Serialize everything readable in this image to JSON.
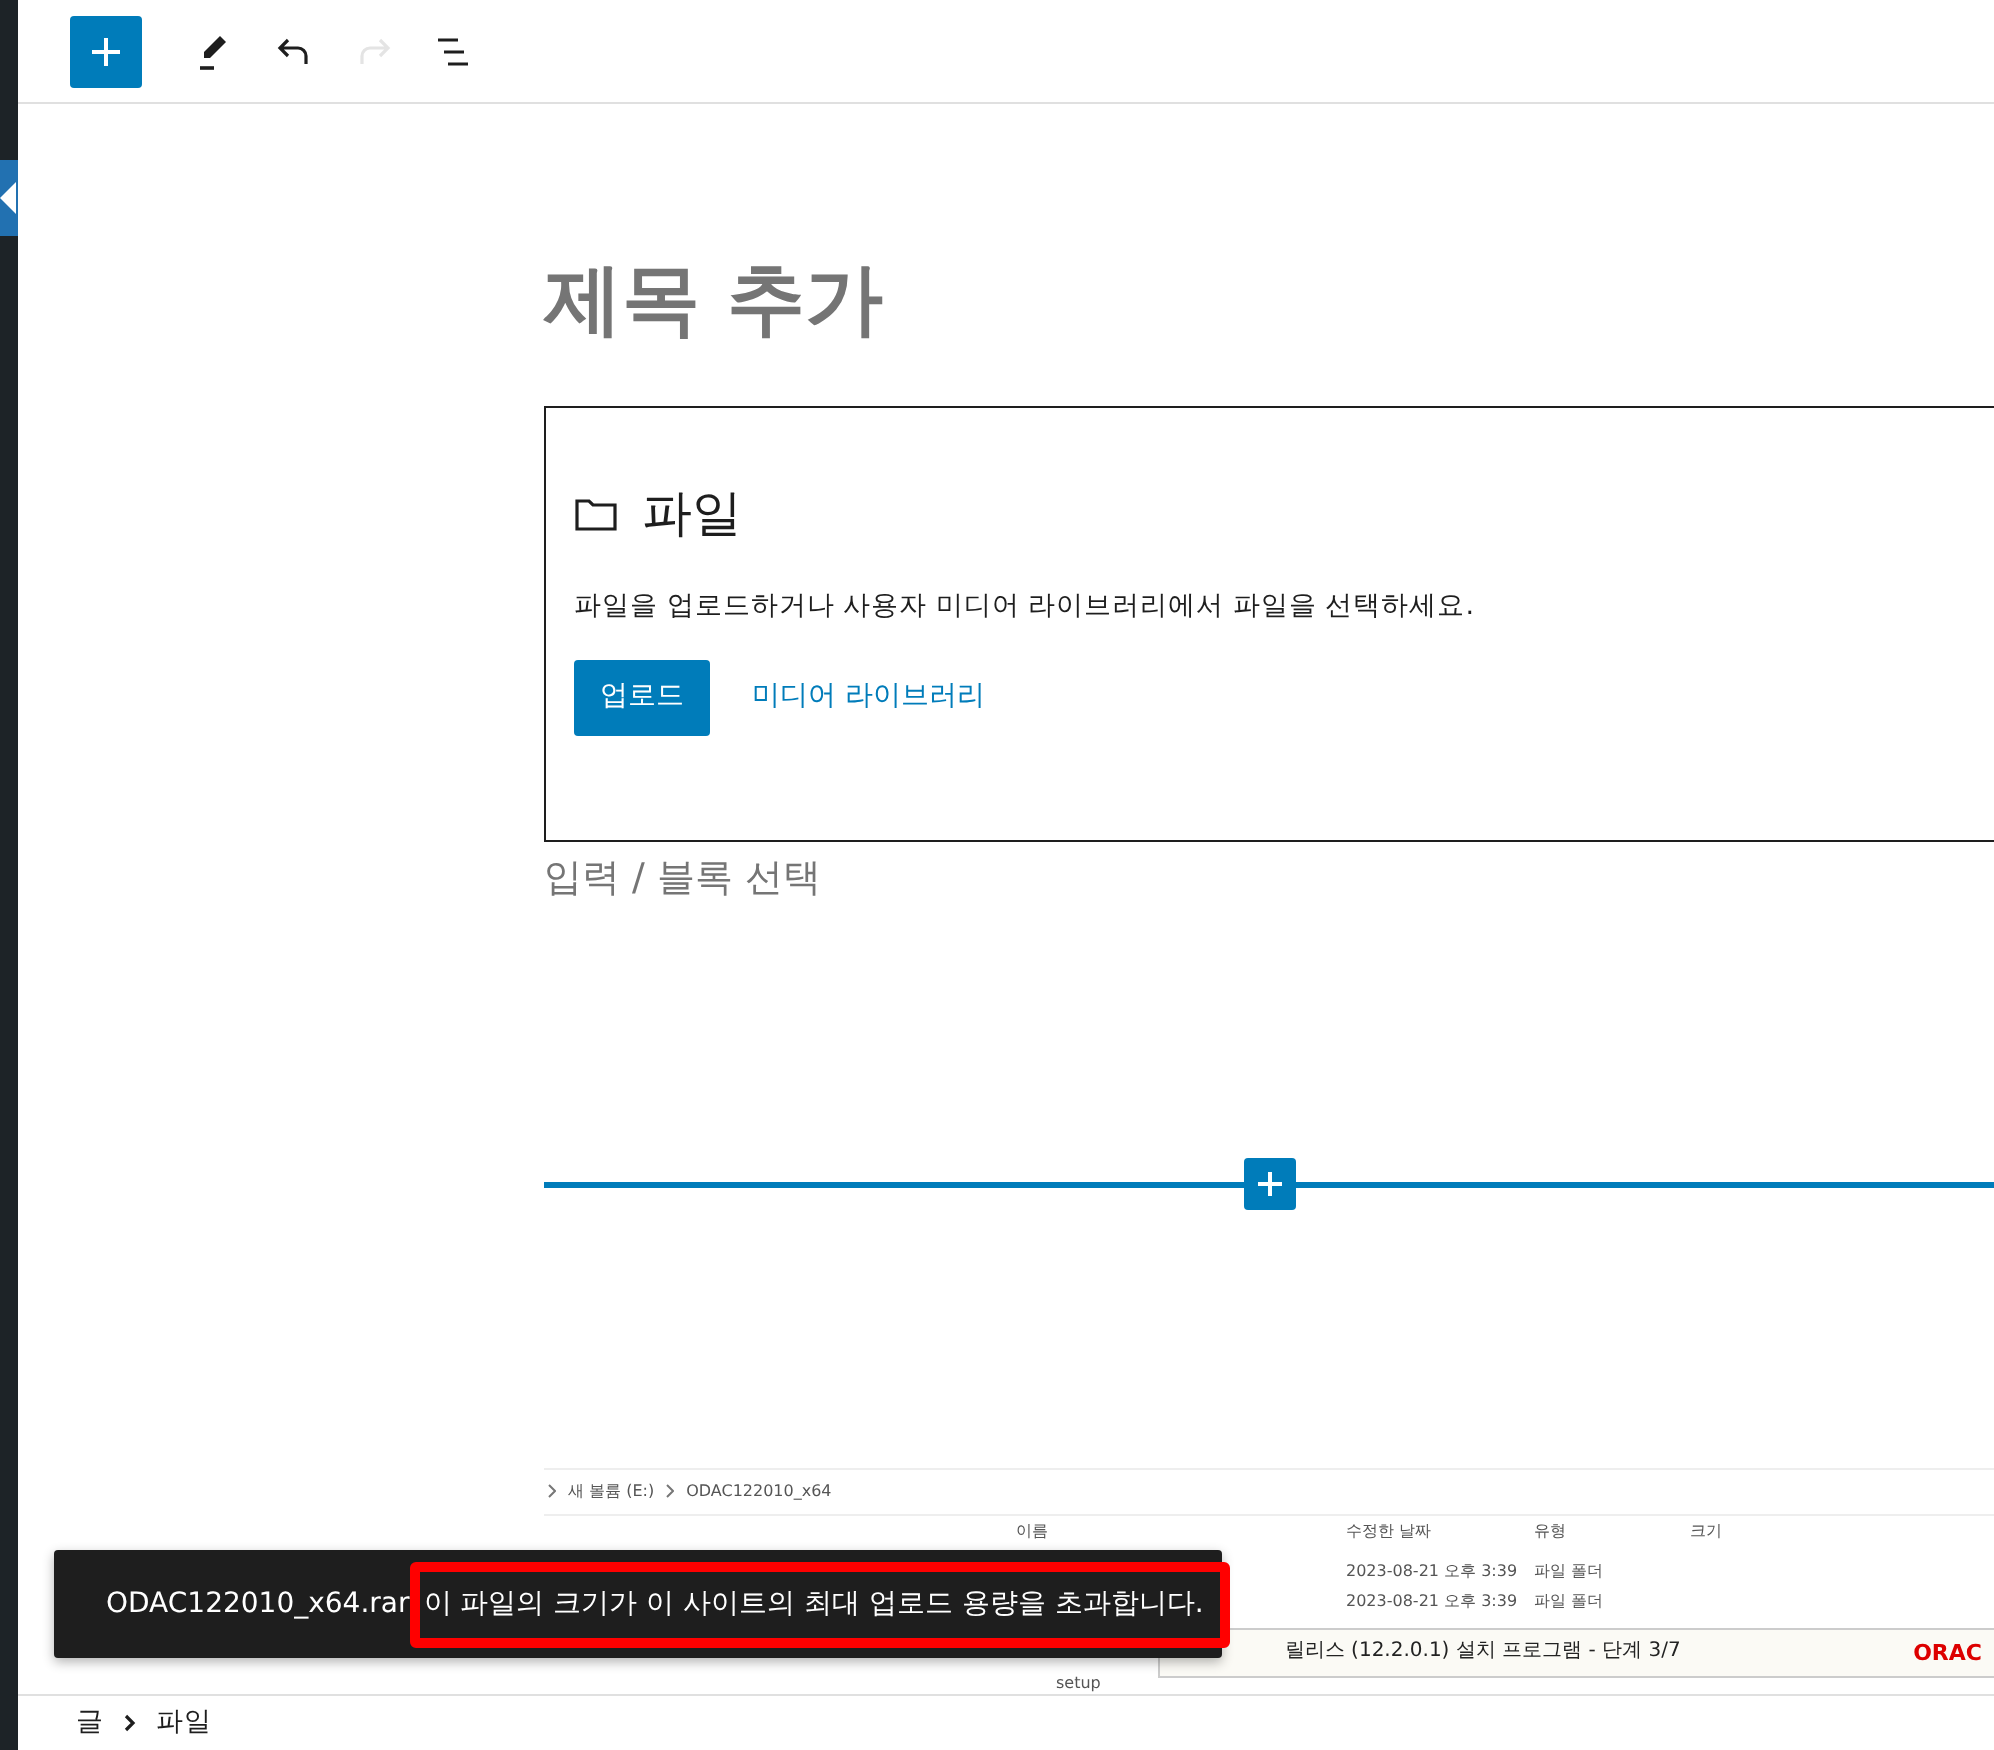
{
  "toolbar": {
    "buttons": [
      {
        "kind": "add",
        "disabled": false
      },
      {
        "kind": "edit",
        "disabled": false
      },
      {
        "kind": "undo",
        "disabled": false
      },
      {
        "kind": "redo",
        "disabled": true
      },
      {
        "kind": "outline",
        "disabled": false
      }
    ]
  },
  "title_placeholder": "제목 추가",
  "file_block": {
    "title": "파일",
    "instructions": "파일을 업로드하거나 사용자 미디어 라이브러리에서 파일을 선택하세요.",
    "upload_button": "업로드",
    "media_library_link": "미디어 라이브러리"
  },
  "block_placeholder": "입력 / 블록 선택",
  "embedded_screenshot": {
    "path": [
      "새 볼륨 (E:)",
      "ODAC122010_x64"
    ],
    "columns": [
      "이름",
      "수정한 날짜",
      "유형",
      "크기"
    ],
    "rows": [
      {
        "modified": "2023-08-21 오후 3:39",
        "type": "파일 폴더"
      },
      {
        "modified": "2023-08-21 오후 3:39",
        "type": "파일 폴더"
      }
    ],
    "item_name": "setup",
    "dialog_title": "릴리스 (12.2.0.1) 설치 프로그램 - 단계 3/7",
    "logo_text": "ORAC"
  },
  "notice": {
    "filename": "ODAC122010_x64.rar",
    "message": "이 파일의 크기가 이 사이트의 최대 업로드 용량을 초과합니다.",
    "highlighted": true
  },
  "breadcrumb": [
    "글",
    "파일"
  ]
}
